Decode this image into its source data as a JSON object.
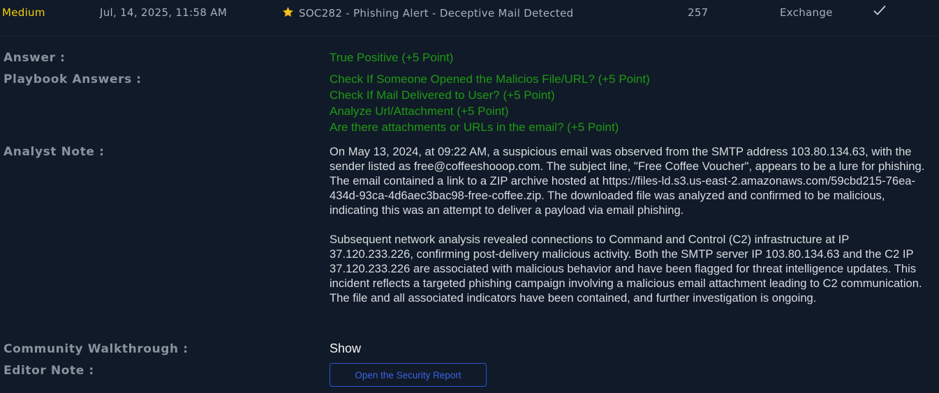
{
  "alert_row": {
    "severity": "Medium",
    "date": "Jul, 14, 2025, 11:58 AM",
    "title": "SOC282 - Phishing Alert - Deceptive Mail Detected",
    "event_id": "257",
    "source": "Exchange",
    "star_icon": "star-icon",
    "check_icon": "checkmark-icon",
    "severity_color": "#f4d20b"
  },
  "details": {
    "answer_label": "Answer :",
    "answer_value": "True Positive (+5 Point)",
    "playbook_label": "Playbook Answers :",
    "playbook_answers": [
      "Check If Someone Opened the Malicios File/URL? (+5 Point)",
      "Check If Mail Delivered to User? (+5 Point)",
      "Analyze Url/Attachment (+5 Point)",
      "Are there attachments or URLs in the email? (+5 Point)"
    ],
    "analyst_note_label": "Analyst Note :",
    "analyst_note_paragraphs": [
      "On May 13, 2024, at 09:22 AM, a suspicious email was observed from the SMTP address 103.80.134.63, with the sender listed as free@coffeeshooop.com. The subject line, \"Free Coffee Voucher\", appears to be a lure for phishing. The email contained a link to a ZIP archive hosted at https://files-ld.s3.us-east-2.amazonaws.com/59cbd215-76ea-434d-93ca-4d6aec3bac98-free-coffee.zip. The downloaded file was analyzed and confirmed to be malicious, indicating this was an attempt to deliver a payload via email phishing.",
      "Subsequent network analysis revealed connections to Command and Control (C2) infrastructure at IP 37.120.233.226, confirming post-delivery malicious activity. Both the SMTP server IP 103.80.134.63 and the C2 IP 37.120.233.226 are associated with malicious behavior and have been flagged for threat intelligence updates. This incident reflects a targeted phishing campaign involving a malicious email attachment leading to C2 communication. The file and all associated indicators have been contained, and further investigation is ongoing."
    ],
    "walkthrough_label": "Community Walkthrough :",
    "walkthrough_value": "Show",
    "editor_note_label": "Editor Note :",
    "security_report_button": "Open the Security Report"
  },
  "colors": {
    "background": "#111a28",
    "answer_green": "#1e9a14",
    "button_blue": "#2f55d8"
  }
}
